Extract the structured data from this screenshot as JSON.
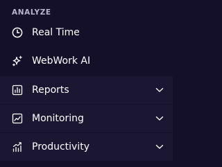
{
  "sidebar": {
    "section_title": "ANALYZE",
    "items": [
      {
        "label": "Real Time",
        "icon": "clock-icon",
        "expandable": false
      },
      {
        "label": "WebWork AI",
        "icon": "sparkle-icon",
        "expandable": false
      },
      {
        "label": "Reports",
        "icon": "bar-chart-icon",
        "expandable": true
      },
      {
        "label": "Monitoring",
        "icon": "line-chart-icon",
        "expandable": true
      },
      {
        "label": "Productivity",
        "icon": "growth-chart-icon",
        "expandable": true
      }
    ]
  },
  "colors": {
    "background": "#14102a",
    "row_highlight": "#1b1733",
    "section_title": "#b9b3cc",
    "text": "#ffffff"
  }
}
